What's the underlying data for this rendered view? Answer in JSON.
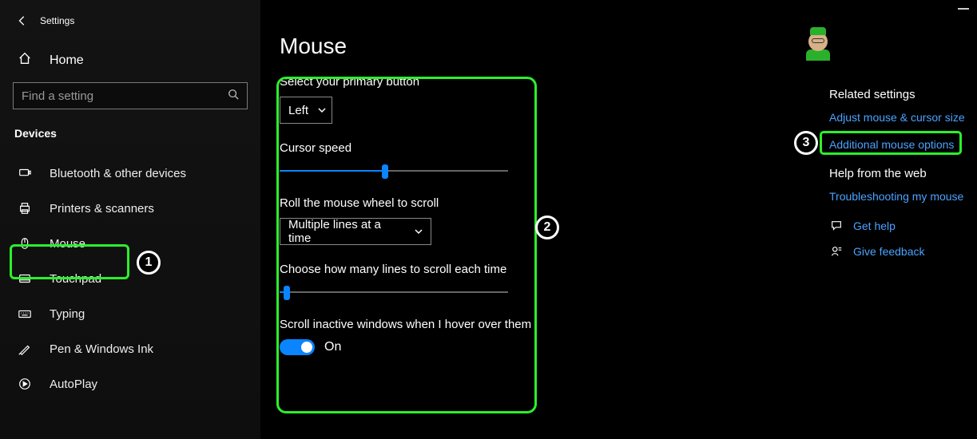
{
  "window": {
    "title": "Settings"
  },
  "sidebar": {
    "home": "Home",
    "search_placeholder": "Find a setting",
    "group": "Devices",
    "items": [
      {
        "key": "bluetooth",
        "label": "Bluetooth & other devices"
      },
      {
        "key": "printers",
        "label": "Printers & scanners"
      },
      {
        "key": "mouse",
        "label": "Mouse",
        "selected": true
      },
      {
        "key": "touchpad",
        "label": "Touchpad"
      },
      {
        "key": "typing",
        "label": "Typing"
      },
      {
        "key": "pen",
        "label": "Pen & Windows Ink"
      },
      {
        "key": "autoplay",
        "label": "AutoPlay"
      }
    ]
  },
  "main": {
    "title": "Mouse",
    "primary_button": {
      "label": "Select your primary button",
      "value": "Left"
    },
    "cursor_speed": {
      "label": "Cursor speed",
      "value": 46,
      "min": 0,
      "max": 100
    },
    "wheel_mode": {
      "label": "Roll the mouse wheel to scroll",
      "value": "Multiple lines at a time"
    },
    "lines_to_scroll": {
      "label": "Choose how many lines to scroll each time",
      "value": 3,
      "min": 0,
      "max": 100
    },
    "scroll_inactive": {
      "label": "Scroll inactive windows when I hover over them",
      "value": "On"
    }
  },
  "right": {
    "related_heading": "Related settings",
    "link_cursor_size": "Adjust mouse & cursor size",
    "link_additional": "Additional mouse options",
    "help_heading": "Help from the web",
    "link_troubleshoot": "Troubleshooting my mouse",
    "get_help": "Get help",
    "give_feedback": "Give feedback"
  },
  "annotations": {
    "step1": "1",
    "step2": "2",
    "step3": "3"
  }
}
